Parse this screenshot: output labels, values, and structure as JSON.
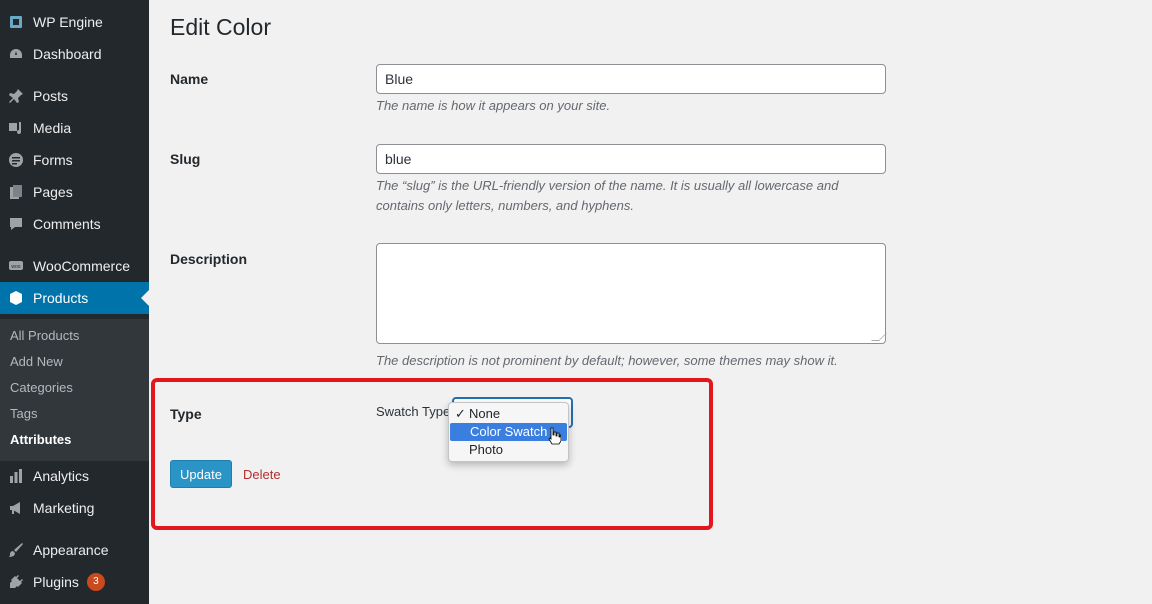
{
  "sidebar": {
    "items": [
      {
        "label": "WP Engine",
        "icon": "wp-engine-icon"
      },
      {
        "label": "Dashboard",
        "icon": "dashboard-icon"
      },
      {
        "label": "Posts",
        "icon": "pushpin-icon"
      },
      {
        "label": "Media",
        "icon": "media-icon"
      },
      {
        "label": "Forms",
        "icon": "forms-icon"
      },
      {
        "label": "Pages",
        "icon": "pages-icon"
      },
      {
        "label": "Comments",
        "icon": "comment-icon"
      },
      {
        "label": "WooCommerce",
        "icon": "woocommerce-icon"
      },
      {
        "label": "Products",
        "icon": "products-icon"
      },
      {
        "label": "Analytics",
        "icon": "bar-chart-icon"
      },
      {
        "label": "Marketing",
        "icon": "megaphone-icon"
      },
      {
        "label": "Appearance",
        "icon": "paintbrush-icon"
      },
      {
        "label": "Plugins",
        "icon": "plugin-icon",
        "badge": "3"
      }
    ],
    "submenu": [
      {
        "label": "All Products"
      },
      {
        "label": "Add New"
      },
      {
        "label": "Categories"
      },
      {
        "label": "Tags"
      },
      {
        "label": "Attributes"
      }
    ]
  },
  "main": {
    "title": "Edit Color",
    "name": {
      "label": "Name",
      "value": "Blue",
      "description": "The name is how it appears on your site."
    },
    "slug": {
      "label": "Slug",
      "value": "blue",
      "description_line1": "The “slug” is the URL-friendly version of the name. It is usually all lowercase and",
      "description_line2": "contains only letters, numbers, and hyphens."
    },
    "description": {
      "label": "Description",
      "value": "",
      "help": "The description is not prominent by default; however, some themes may show it."
    },
    "type": {
      "label": "Type",
      "swatch_label": "Swatch Type",
      "selected": "None",
      "options": [
        "None",
        "Color Swatch",
        "Photo"
      ]
    },
    "update_label": "Update",
    "delete_label": "Delete"
  },
  "colors": {
    "highlight": "#e3161e",
    "active_menu": "#0073aa",
    "update_button": "#2a94c6",
    "dropdown_hover": "#3a7ee0"
  }
}
